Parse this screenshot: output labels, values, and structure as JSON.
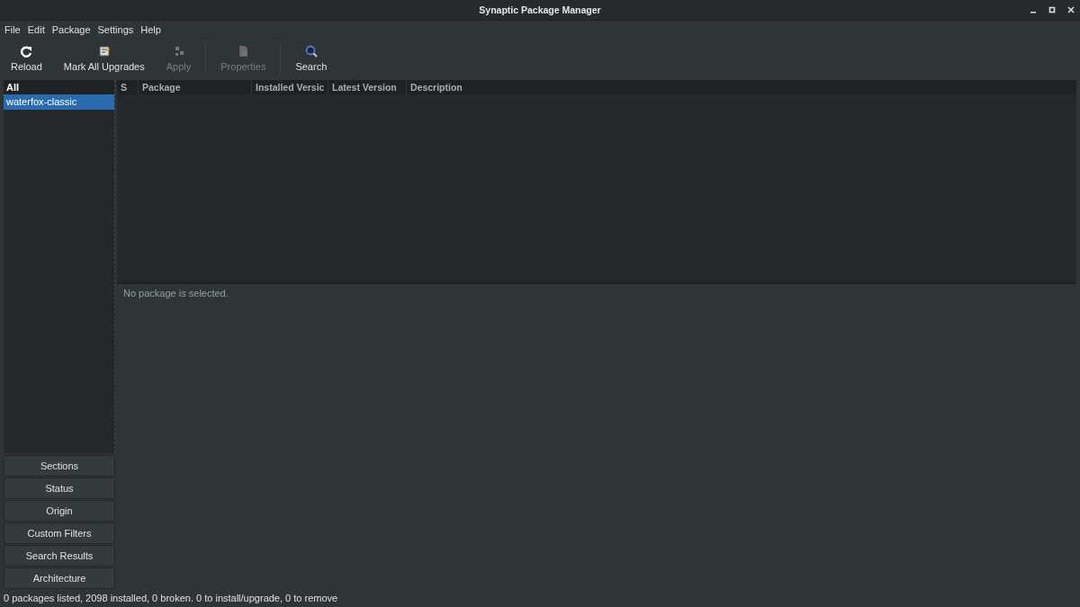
{
  "window": {
    "title": "Synaptic Package Manager"
  },
  "menu": [
    "File",
    "Edit",
    "Package",
    "Settings",
    "Help"
  ],
  "toolbar": [
    {
      "kind": "reload",
      "label": "Reload",
      "disabled": false
    },
    {
      "kind": "upgrade",
      "label": "Mark All Upgrades",
      "disabled": false
    },
    {
      "kind": "apply",
      "label": "Apply",
      "disabled": true
    },
    {
      "kind": "properties",
      "label": "Properties",
      "disabled": true
    },
    {
      "kind": "search",
      "label": "Search",
      "disabled": false
    }
  ],
  "filter_list": {
    "heading": "All",
    "items": [
      {
        "label": "waterfox-classic",
        "selected": true
      }
    ]
  },
  "filter_buttons": [
    "Sections",
    "Status",
    "Origin",
    "Custom Filters",
    "Search Results",
    "Architecture"
  ],
  "table": {
    "columns": [
      "S",
      "Package",
      "Installed Versic",
      "Latest Version",
      "Description"
    ]
  },
  "details": {
    "text": "No package is selected."
  },
  "status_bar": "0 packages listed, 2098 installed, 0 broken. 0 to install/upgrade, 0 to remove"
}
